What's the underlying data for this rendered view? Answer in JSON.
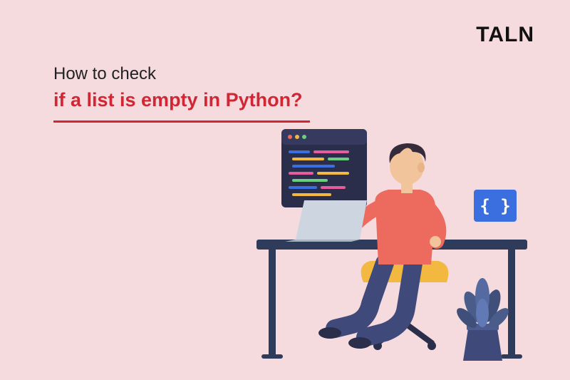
{
  "logo": "TALN",
  "heading": {
    "line1": "How to check",
    "line2": "if a list is empty in Python?"
  },
  "illustration": {
    "badge_text": "{ }",
    "colors": {
      "desk": "#2e3b5a",
      "shirt": "#ec6a5e",
      "pants": "#3f4a7a",
      "hair": "#362b3a",
      "skin": "#f2c49b",
      "laptop": "#cdd6e0",
      "monitor_bg": "#2a2e4a",
      "badge_bg": "#3b6fe0",
      "chair": "#f2b83f",
      "plant_pot": "#3f4a7a",
      "plant_leaves": "#4a5c8a"
    }
  }
}
